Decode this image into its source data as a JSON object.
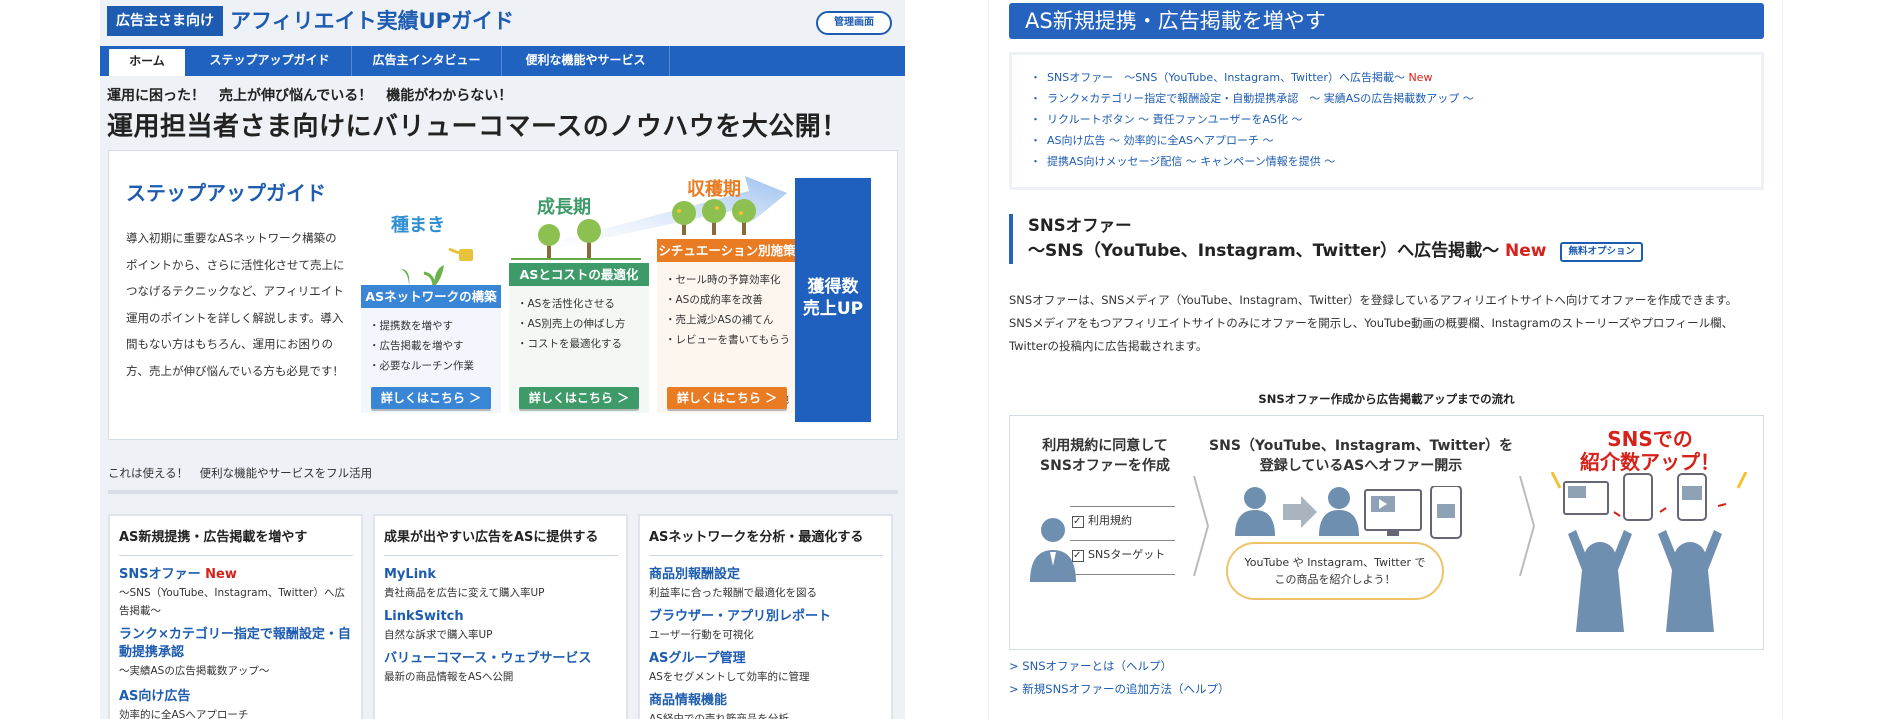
{
  "left": {
    "advertiser_tag": "広告主さま向け",
    "guide_title": "アフィリエイト実績UPガイド",
    "admin_button": "管理画面",
    "nav": [
      "ホーム",
      "ステップアップガイド",
      "広告主インタビュー",
      "便利な機能やサービス"
    ],
    "intro_small": "運用に困った！　売上が伸び悩んでいる！　機能がわからない！",
    "intro_big": "運用担当者さま向けにバリューコマースのノウハウを大公開！",
    "card": {
      "title": "ステップアップガイド",
      "text": "導入初期に重要なASネットワーク構築のポイントから、さらに活性化させて売上につなげるテクニックなど、アフィリエイト運用のポイントを詳しく解説します。導入間もない方はもちろん、運用にお困りの方、売上が伸び悩んでいる方も必見です！",
      "stages": [
        {
          "label": "種まき",
          "head": "ASネットワークの構築",
          "items": [
            "提携数を増やす",
            "広告掲載を増やす",
            "必要なルーチン作業"
          ],
          "button": "詳しくはこちら ＞"
        },
        {
          "label": "成長期",
          "head": "ASとコストの最適化",
          "items": [
            "ASを活性化させる",
            "AS別売上の伸ばし方",
            "コストを最適化する"
          ],
          "button": "詳しくはこちら ＞"
        },
        {
          "label": "収穫期",
          "head": "シチュエーション別施策",
          "items": [
            "セール時の予算効率化",
            "ASの成約率を改善",
            "売上減少ASの補てん",
            "レビューを書いてもらう"
          ],
          "extra": "他",
          "button": "詳しくはこちら ＞"
        }
      ],
      "final_line1": "獲得数",
      "final_line2": "売上UP"
    },
    "feature_lead": "これは使える！　便利な機能やサービスをフル活用",
    "columns": [
      {
        "head": "AS新規提携・広告掲載を増やす",
        "items": [
          {
            "title": "SNSオファー",
            "new": "New",
            "desc": "〜SNS（YouTube、Instagram、Twitter）へ広告掲載〜"
          },
          {
            "title": "ランク×カテゴリー指定で報酬設定・自動提携承認",
            "desc": "〜実績ASの広告掲載数アップ〜"
          },
          {
            "title": "AS向け広告",
            "desc": "効率的に全ASへアプローチ"
          }
        ]
      },
      {
        "head": "成果が出やすい広告をASに提供する",
        "items": [
          {
            "title": "MyLink",
            "desc": "貴社商品を広告に変えて購入率UP"
          },
          {
            "title": "LinkSwitch",
            "desc": "自然な訴求で購入率UP"
          },
          {
            "title": "バリューコマース・ウェブサービス",
            "desc": "最新の商品情報をASへ公開"
          }
        ]
      },
      {
        "head": "ASネットワークを分析・最適化する",
        "items": [
          {
            "title": "商品別報酬設定",
            "desc": "利益率に合った報酬で最適化を図る"
          },
          {
            "title": "ブラウザー・アプリ別レポート",
            "desc": "ユーザー行動を可視化"
          },
          {
            "title": "ASグループ管理",
            "desc": "ASをセグメントして効率的に管理"
          },
          {
            "title": "商品情報機能",
            "desc": "AS経由での売れ筋商品を分析"
          }
        ]
      }
    ]
  },
  "right": {
    "banner": "AS新規提携・広告掲載を増やす",
    "list": [
      {
        "text": "SNSオファー　〜SNS（YouTube、Instagram、Twitter）へ広告掲載〜 ",
        "new": "New"
      },
      {
        "text": "ランク×カテゴリー指定で報酬設定・自動提携承認　〜 実績ASの広告掲載数アップ 〜"
      },
      {
        "text": "リクルートボタン 〜 責任ファンユーザーをAS化 〜"
      },
      {
        "text": "AS向け広告 〜 効率的に全ASへアプローチ 〜"
      },
      {
        "text": "提携AS向けメッセージ配信 〜 キャンペーン情報を提供 〜"
      }
    ],
    "sns_head_line1": "SNSオファー",
    "sns_head_line2": "〜SNS（YouTube、Instagram、Twitter）へ広告掲載〜 ",
    "sns_head_new": "New",
    "free_badge": "無料オプション",
    "description": "SNSオファーは、SNSメディア（YouTube、Instagram、Twitter）を登録しているアフィリエイトサイトへ向けてオファーを作成できます。 SNSメディアをもつアフィリエイトサイトのみにオファーを開示し、YouTube動画の概要欄、Instagramのストーリーズやプロフィール欄、Twitterの投稿内に広告掲載されます。",
    "flow_title": "SNSオファー作成から広告掲載アップまでの流れ",
    "flow": {
      "step1": [
        "利用規約に同意して",
        "SNSオファーを作成"
      ],
      "check1": "利用規約",
      "check2": "SNSターゲット",
      "step2": [
        "SNS（YouTube、Instagram、Twitter）を",
        "登録しているASへオファー開示"
      ],
      "bubble": [
        "YouTube や Instagram、Twitter で",
        "この商品を紹介しよう！"
      ],
      "step3": [
        "SNSでの",
        "紹介数アップ！"
      ]
    },
    "links": [
      "SNSオファーとは（ヘルプ）",
      "新規SNSオファーの追加方法（ヘルプ）"
    ],
    "colors": {
      "brand_blue": "#2563bf",
      "new_red": "#d6221a",
      "growth_green": "#3f9a6a",
      "harvest_orange": "#e97b23"
    }
  }
}
